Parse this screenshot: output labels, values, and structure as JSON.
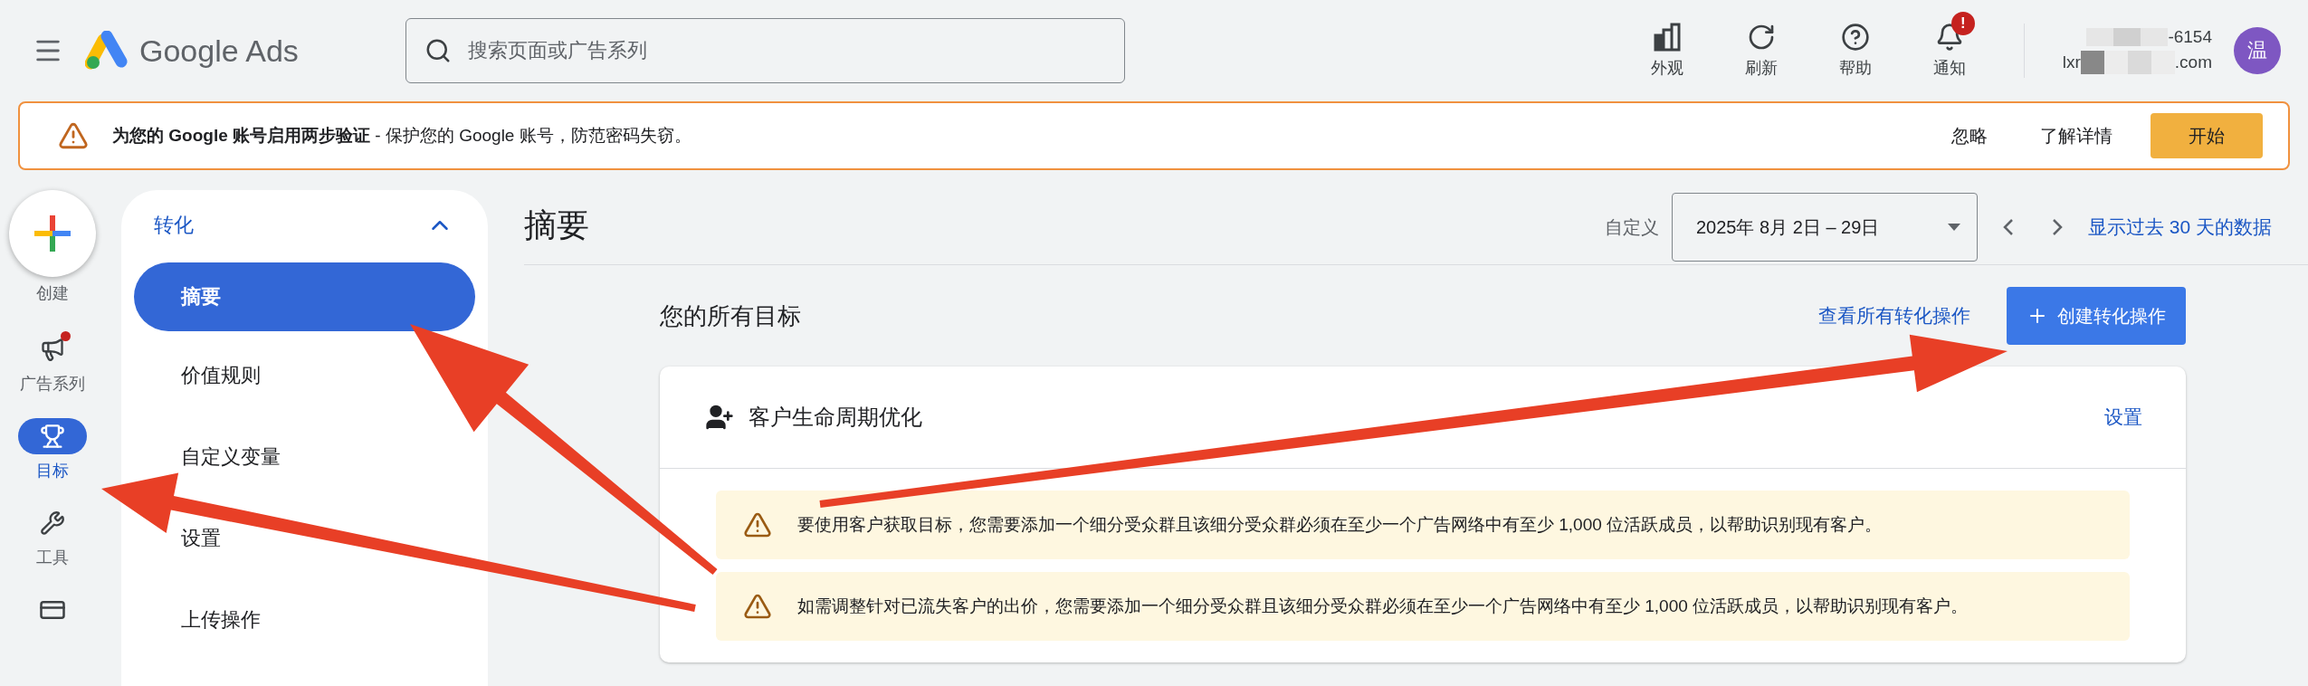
{
  "header": {
    "product": "Google Ads",
    "search": {
      "placeholder": "搜索页面或广告系列"
    },
    "tools": [
      {
        "kind": "appearance",
        "label": "外观",
        "alert": false
      },
      {
        "kind": "refresh",
        "label": "刷新",
        "alert": false
      },
      {
        "kind": "help",
        "label": "帮助",
        "alert": false
      },
      {
        "kind": "notifications",
        "label": "通知",
        "alert": true,
        "badge": "!"
      }
    ],
    "account": {
      "line_1": "-6154",
      "line_2_start": "lxr",
      "line_2_end": ".com",
      "avatar": "温"
    }
  },
  "banner": {
    "message": "**为您的 Google 账号启用两步验证** - 保护您的 Google 账号，防范密码失窃。",
    "actions": [
      {
        "label": "忽略",
        "kind": "text"
      },
      {
        "label": "了解详情",
        "kind": "text"
      },
      {
        "label": "开始",
        "kind": "primary"
      }
    ]
  },
  "rail": {
    "create": "创建",
    "items": [
      {
        "kind": "campaigns",
        "label": "广告系列",
        "selected": false,
        "dot": true
      },
      {
        "kind": "goals",
        "label": "目标",
        "selected": true,
        "dot": false
      },
      {
        "kind": "tools",
        "label": "工具",
        "selected": false,
        "dot": false
      },
      {
        "kind": "billing",
        "selected": false,
        "dot": false
      }
    ]
  },
  "subnav": {
    "title": "转化",
    "expanded": true,
    "items": [
      {
        "label": "摘要",
        "selected": true
      },
      {
        "label": "价值规则",
        "selected": false
      },
      {
        "label": "自定义变量",
        "selected": false
      },
      {
        "label": "设置",
        "selected": false
      },
      {
        "label": "上传操作",
        "selected": false
      }
    ]
  },
  "page": {
    "title": "摘要",
    "date_label": "自定义",
    "date_range": "2025年 8月 2日 – 29日",
    "range_link": "显示过去 30 天的数据"
  },
  "goals": {
    "heading": "您的所有目标",
    "view_all": "查看所有转化操作",
    "create_button": "创建转化操作",
    "card": {
      "title": "客户生命周期优化",
      "action": "设置",
      "alerts": [
        "要使用客户获取目标，您需要添加一个细分受众群且该细分受众群必须在至少一个广告网络中有至少 1,000 位活跃成员，以帮助识别现有客户。",
        "如需调整针对已流失客户的出价，您需要添加一个细分受众群且该细分受众群必须在至少一个广告网络中有至少 1,000 位活跃成员，以帮助识别现有客户。"
      ]
    }
  }
}
